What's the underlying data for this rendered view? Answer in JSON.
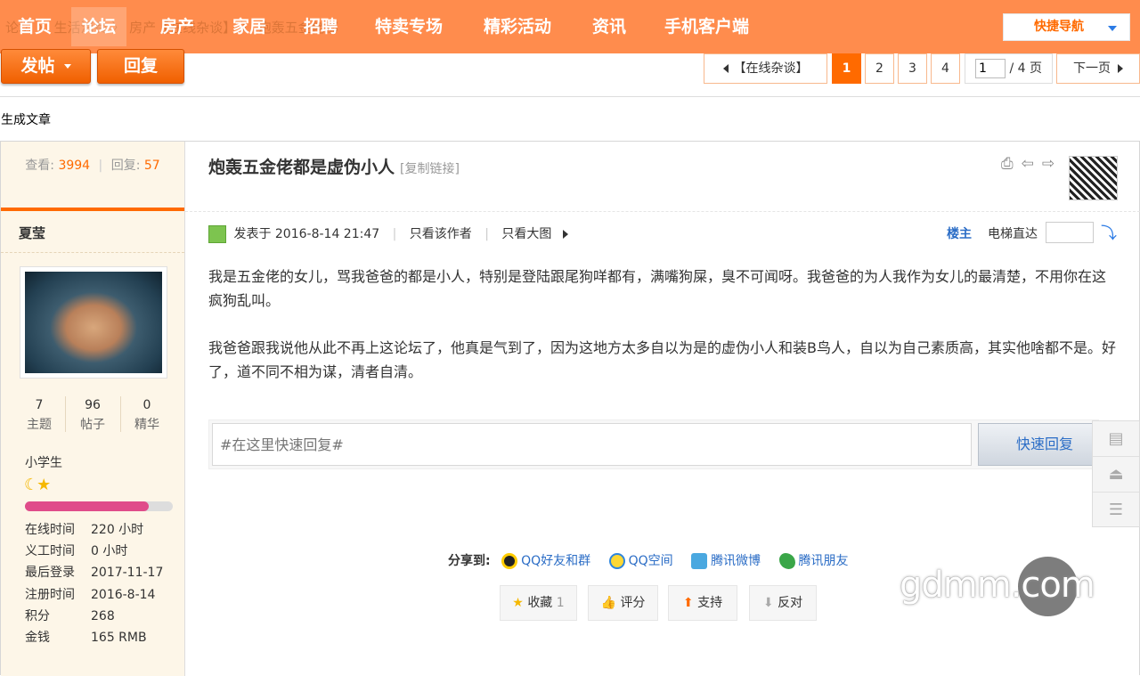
{
  "topnav": {
    "breadcrumb": "论坛 〉 生活消费 〉 房产【在线杂谈】 〉 炮轰五金佬都",
    "items": [
      "首页",
      "论坛",
      "房产",
      "家居",
      "招聘",
      "特卖专场",
      "精彩活动",
      "资讯",
      "手机客户端"
    ],
    "active": "论坛",
    "quicknav": "快捷导航"
  },
  "toolbar": {
    "post_label": "发帖",
    "reply_label": "回复"
  },
  "pagination": {
    "back_label": "【在线杂谈】",
    "pages": [
      "1",
      "2",
      "3",
      "4"
    ],
    "current": "1",
    "input_value": "1",
    "total_label": "/ 4 页",
    "next_label": "下一页"
  },
  "generate_label": "生成文章",
  "sidebar": {
    "view_label": "查看:",
    "views": "3994",
    "reply_label": "回复:",
    "replies": "57",
    "username": "夏莹",
    "stats": [
      {
        "value": "7",
        "label": "主题"
      },
      {
        "value": "96",
        "label": "帖子"
      },
      {
        "value": "0",
        "label": "精华"
      }
    ],
    "rank": "小学生",
    "rank_icons": "☾★",
    "progress": 0.84,
    "info": [
      {
        "k": "在线时间",
        "v": "220 小时"
      },
      {
        "k": "义工时间",
        "v": "0 小时"
      },
      {
        "k": "最后登录",
        "v": "2017-11-17"
      },
      {
        "k": "注册时间",
        "v": "2016-8-14"
      },
      {
        "k": "积分",
        "v": "268"
      },
      {
        "k": "金钱",
        "v": "165 RMB"
      }
    ]
  },
  "post": {
    "title": "炮轰五金佬都是虚伪小人",
    "copy_link": "[复制链接]",
    "posted": "发表于 2016-8-14 21:47",
    "only_author": "只看该作者",
    "only_big": "只看大图",
    "louzhu": "楼主",
    "elevator": "电梯直达",
    "paragraphs": [
      "我是五金佬的女儿，骂我爸爸的都是小人，特别是登陆跟尾狗咩都有，满嘴狗屎，臭不可闻呀。我爸爸的为人我作为女儿的最清楚，不用你在这疯狗乱叫。",
      "我爸爸跟我说他从此不再上这论坛了，他真是气到了，因为这地方太多自以为是的虚伪小人和装B鸟人，自以为自己素质高，其实他啥都不是。好了，道不同不相为谋，清者自清。"
    ]
  },
  "quick_reply": {
    "placeholder": "#在这里快速回复#",
    "button": "快速回复"
  },
  "share": {
    "label": "分享到:",
    "items": [
      "QQ好友和群",
      "QQ空间",
      "腾讯微博",
      "腾讯朋友"
    ]
  },
  "actions": {
    "favorite": "收藏",
    "favorite_count": "1",
    "rate": "评分",
    "support": "支持",
    "oppose": "反对"
  },
  "watermark": "gdmm.com",
  "colors": {
    "accent": "#ff6a00",
    "nav": "#ff8c4d",
    "link": "#2b6dc6"
  }
}
